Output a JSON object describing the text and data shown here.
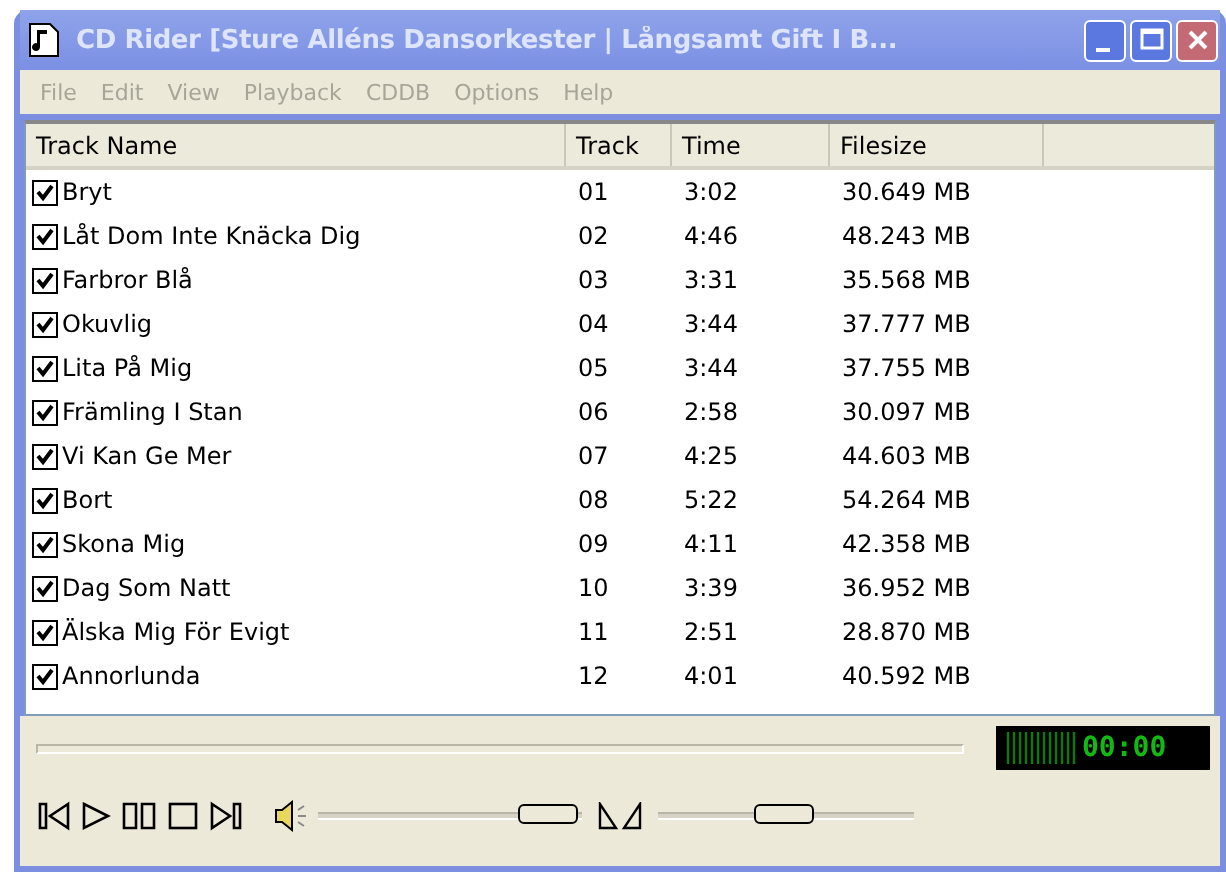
{
  "window": {
    "title": "CD Rider [Sture Alléns Dansorkester  |  Långsamt Gift I B..."
  },
  "menu": [
    "File",
    "Edit",
    "View",
    "Playback",
    "CDDB",
    "Options",
    "Help"
  ],
  "table": {
    "columns": [
      "Track Name",
      "Track",
      "Time",
      "Filesize"
    ],
    "rows": [
      {
        "name": "Bryt",
        "track": "01",
        "time": "3:02",
        "size": "30.649 MB",
        "checked": true
      },
      {
        "name": "Låt Dom Inte Knäcka Dig",
        "track": "02",
        "time": "4:46",
        "size": "48.243 MB",
        "checked": true
      },
      {
        "name": "Farbror Blå",
        "track": "03",
        "time": "3:31",
        "size": "35.568 MB",
        "checked": true
      },
      {
        "name": "Okuvlig",
        "track": "04",
        "time": "3:44",
        "size": "37.777 MB",
        "checked": true
      },
      {
        "name": "Lita På Mig",
        "track": "05",
        "time": "3:44",
        "size": "37.755 MB",
        "checked": true
      },
      {
        "name": "Främling I Stan",
        "track": "06",
        "time": "2:58",
        "size": "30.097 MB",
        "checked": true
      },
      {
        "name": "Vi Kan Ge Mer",
        "track": "07",
        "time": "4:25",
        "size": "44.603 MB",
        "checked": true
      },
      {
        "name": "Bort",
        "track": "08",
        "time": "5:22",
        "size": "54.264 MB",
        "checked": true
      },
      {
        "name": "Skona Mig",
        "track": "09",
        "time": "4:11",
        "size": "42.358 MB",
        "checked": true
      },
      {
        "name": "Dag Som Natt",
        "track": "10",
        "time": "3:39",
        "size": "36.952 MB",
        "checked": true
      },
      {
        "name": "Älska Mig För Evigt",
        "track": "11",
        "time": "2:51",
        "size": "28.870 MB",
        "checked": true
      },
      {
        "name": "Annorlunda",
        "track": "12",
        "time": "4:01",
        "size": "40.592 MB",
        "checked": true
      }
    ]
  },
  "player": {
    "display": "00:00",
    "volume": {
      "level": 0.88
    },
    "balance": {
      "level": 0.5
    }
  }
}
